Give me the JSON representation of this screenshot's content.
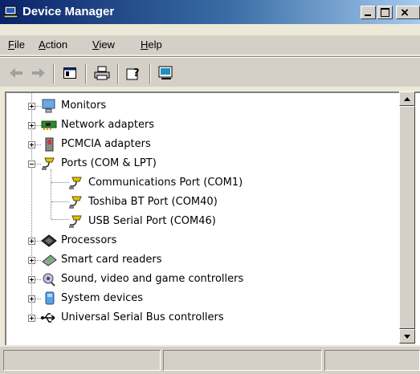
{
  "window": {
    "title": "Device Manager",
    "icons": {
      "app": "device-manager-icon",
      "minimize": "minimize-icon",
      "maximize": "maximize-icon",
      "close": "close-icon"
    }
  },
  "menu": {
    "file": {
      "key": "F",
      "rest": "ile"
    },
    "action": {
      "key": "A",
      "rest": "ction"
    },
    "view": {
      "key": "V",
      "rest": "iew"
    },
    "help": {
      "key": "H",
      "rest": "elp"
    }
  },
  "toolbar": [
    "back-arrow-icon",
    "forward-arrow-icon",
    "show-hide-console-tree-icon",
    "print-icon",
    "help-icon",
    "properties-icon"
  ],
  "tree": {
    "items": [
      {
        "label": "Monitors",
        "icon": "monitor-icon"
      },
      {
        "label": "Network adapters",
        "icon": "network-adapter-icon"
      },
      {
        "label": "PCMCIA adapters",
        "icon": "pcmcia-icon"
      },
      {
        "label": "Ports (COM & LPT)",
        "icon": "port-icon"
      },
      {
        "label": "Communications Port (COM1)",
        "icon": "port-icon"
      },
      {
        "label": "Toshiba BT Port (COM40)",
        "icon": "port-icon"
      },
      {
        "label": "USB Serial Port (COM46)",
        "icon": "port-icon"
      },
      {
        "label": "Processors",
        "icon": "processor-icon"
      },
      {
        "label": "Smart card readers",
        "icon": "smart-card-reader-icon"
      },
      {
        "label": "Sound, video and game controllers",
        "icon": "sound-icon"
      },
      {
        "label": "System devices",
        "icon": "system-device-icon"
      },
      {
        "label": "Universal Serial Bus controllers",
        "icon": "usb-icon"
      }
    ]
  },
  "colors": {
    "title_start": "#0a246a",
    "title_end": "#a6caf0",
    "face": "#d4d0c8",
    "tree_bg": "#ffffff"
  }
}
